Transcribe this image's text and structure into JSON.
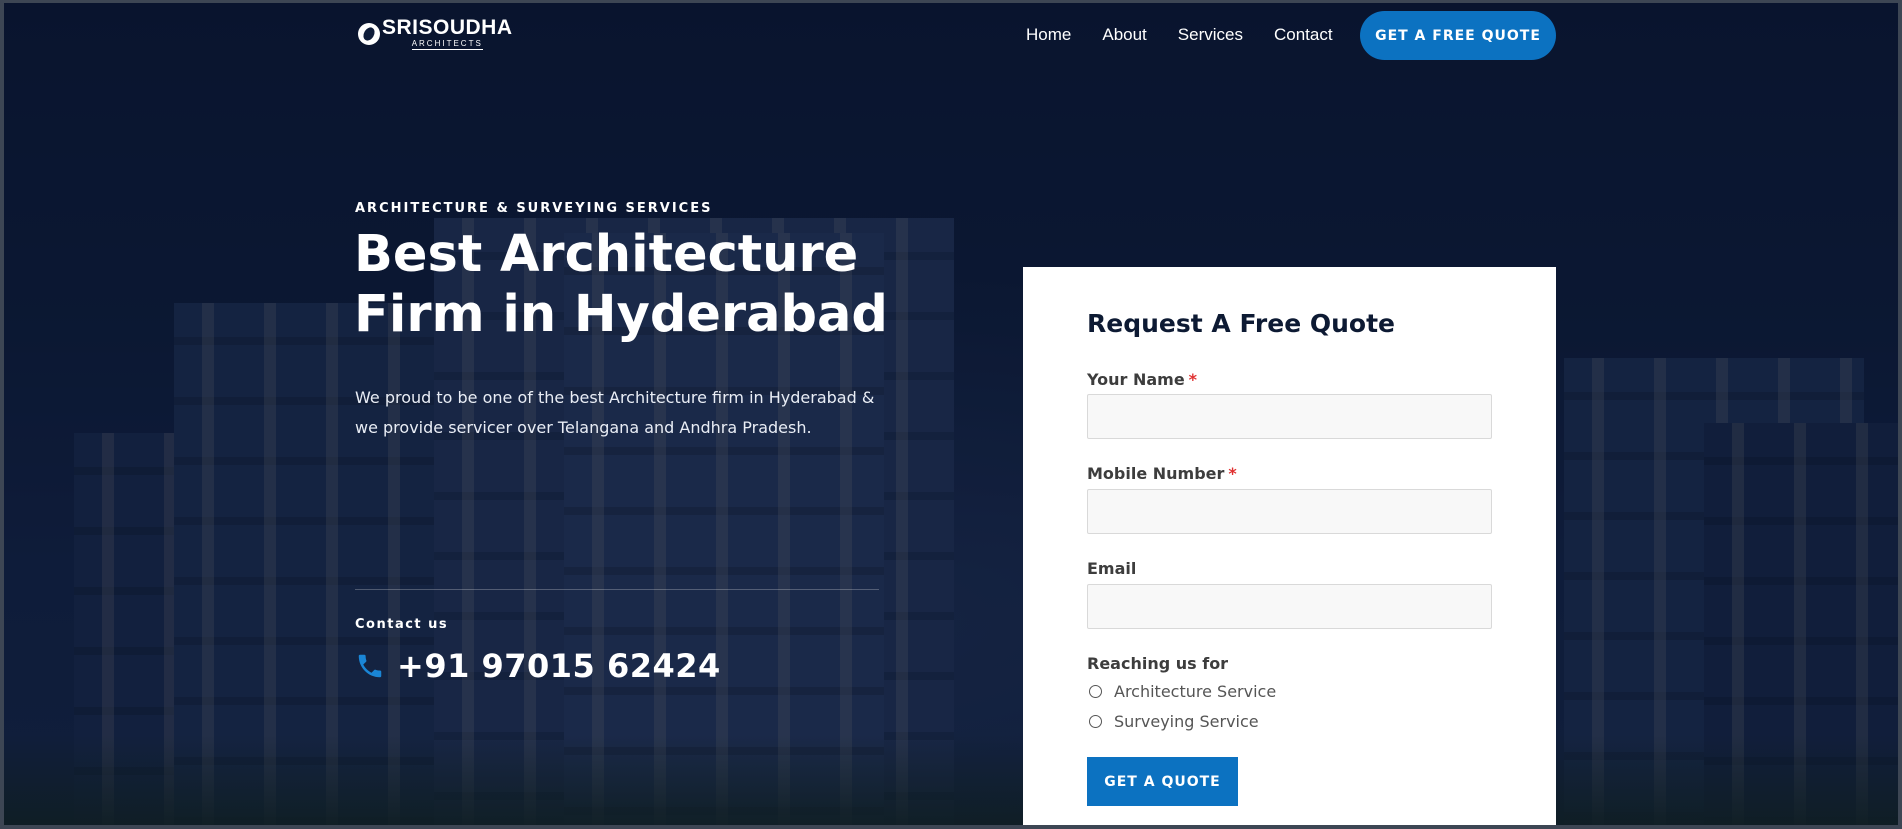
{
  "brand": {
    "name": "SRISOUDHA",
    "tagline": "ARCHITECTS"
  },
  "nav": {
    "items": [
      {
        "label": "Home"
      },
      {
        "label": "About"
      },
      {
        "label": "Services"
      },
      {
        "label": "Contact"
      }
    ],
    "cta_label": "GET A FREE QUOTE"
  },
  "hero": {
    "eyebrow": "ARCHITECTURE & SURVEYING SERVICES",
    "headline_line1": "Best Architecture",
    "headline_line2": "Firm in Hyderabad",
    "lead": "We proud to be one of the best Architecture firm in Hyderabad & we provide servicer over Telangana and Andhra Pradesh.",
    "contact_label": "Contact us",
    "phone": "+91 97015 62424",
    "phone_icon": "phone-icon"
  },
  "form": {
    "title": "Request A Free Quote",
    "fields": {
      "name": {
        "label": "Your Name",
        "required_mark": "*",
        "value": ""
      },
      "mobile": {
        "label": "Mobile Number",
        "required_mark": "*",
        "value": ""
      },
      "email": {
        "label": "Email",
        "value": ""
      }
    },
    "reason": {
      "label": "Reaching us for",
      "options": [
        {
          "label": "Architecture Service",
          "checked": false
        },
        {
          "label": "Surveying Service",
          "checked": false
        }
      ]
    },
    "submit_label": "GET A QUOTE"
  },
  "colors": {
    "accent": "#0c72c1",
    "hero_bg": "#0d1a33",
    "required": "#e03131",
    "card_bg": "#ffffff"
  }
}
